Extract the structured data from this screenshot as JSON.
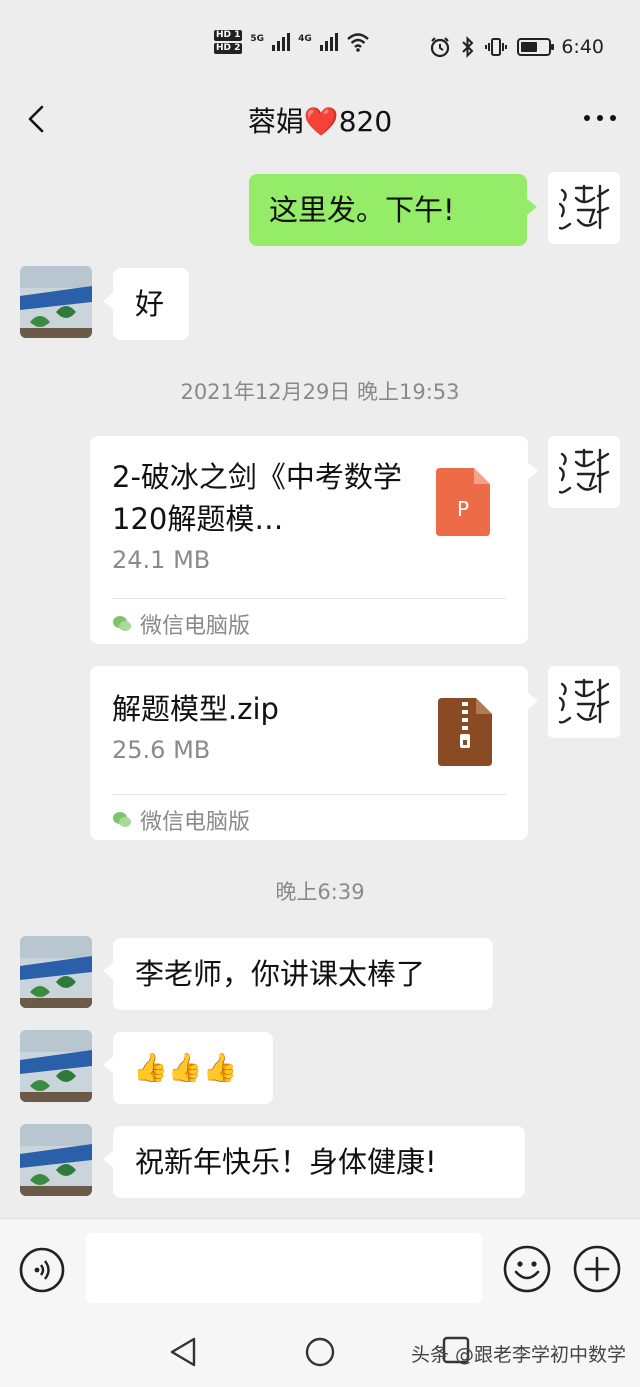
{
  "status": {
    "hd1": "HD 1",
    "hd2": "HD 2",
    "net1": "5G",
    "net2": "4G",
    "time": "6:40",
    "battery_level": 0.6
  },
  "header": {
    "title": "蓉娟❤️820"
  },
  "messages": [
    {
      "side": "mine",
      "text": "这里发。下午!"
    },
    {
      "side": "theirs",
      "text": "好"
    },
    {
      "side": "theirs",
      "text": "李老师，你讲课太棒了"
    },
    {
      "side": "theirs",
      "text": "👍👍👍"
    },
    {
      "side": "theirs",
      "text": "祝新年快乐！身体健康!"
    }
  ],
  "timestamps": [
    "2021年12月29日 晚上19:53",
    "晚上6:39"
  ],
  "files": [
    {
      "name": "2-破冰之剑《中考数学120解题模…",
      "size": "24.1 MB",
      "source": "微信电脑版",
      "icon": "ppt-file-icon",
      "icon_letter": "P",
      "icon_color": "#ed6c47"
    },
    {
      "name": "解题模型.zip",
      "size": "25.6 MB",
      "source": "微信电脑版",
      "icon": "zip-file-icon",
      "icon_color": "#8a4b24"
    }
  ],
  "input": {
    "placeholder": ""
  },
  "watermark": "头条 @跟老李学初中数学",
  "colors": {
    "mine_bubble": "#95ec69",
    "background": "#ededed"
  }
}
